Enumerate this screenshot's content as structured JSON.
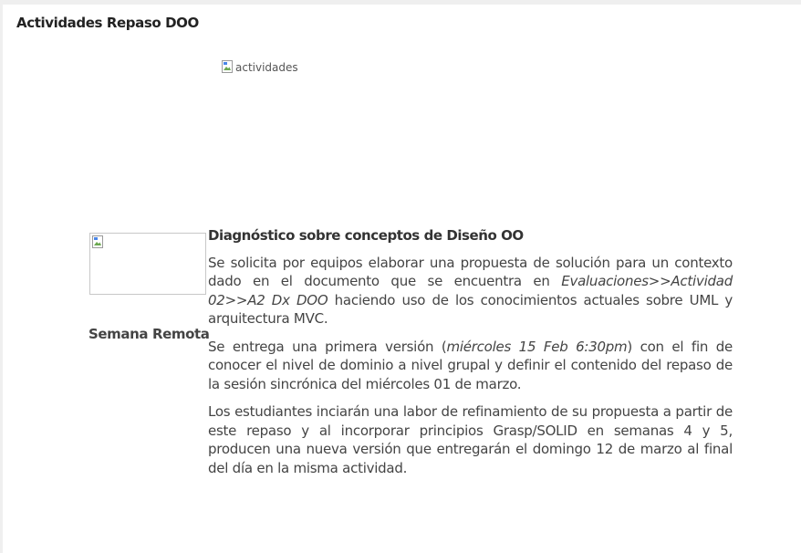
{
  "page": {
    "title": "Actividades Repaso DOO"
  },
  "hero_image": {
    "alt": "actividades",
    "icon": "broken-image-icon"
  },
  "thumbnail": {
    "icon": "broken-image-icon"
  },
  "week": {
    "label": "Semana Remota"
  },
  "activity": {
    "heading": "Diagnóstico sobre conceptos de Diseño OO",
    "p1": {
      "before": "Se solicita por equipos elaborar una propuesta de solución para un contexto dado en el documento que se encuentra en ",
      "emphasis": "Evaluaciones>>Actividad 02>>A2 Dx DOO",
      "after": " haciendo uso de los conocimientos actuales sobre UML y arquitectura MVC."
    },
    "p2": {
      "before": "Se entrega una primera versión (",
      "emphasis": "miércoles 15 Feb 6:30pm",
      "after": ") con el fin de conocer el nivel de dominio a nivel grupal y definir el contenido del repaso de la sesión sincrónica del miércoles 01 de marzo."
    },
    "p3": "Los estudiantes inciarán una labor de refinamiento de su propuesta a partir de este repaso y al incorporar principios Grasp/SOLID en semanas 4 y 5, producen una nueva versión que entregarán el domingo 12 de marzo al final del día en la misma actividad."
  }
}
